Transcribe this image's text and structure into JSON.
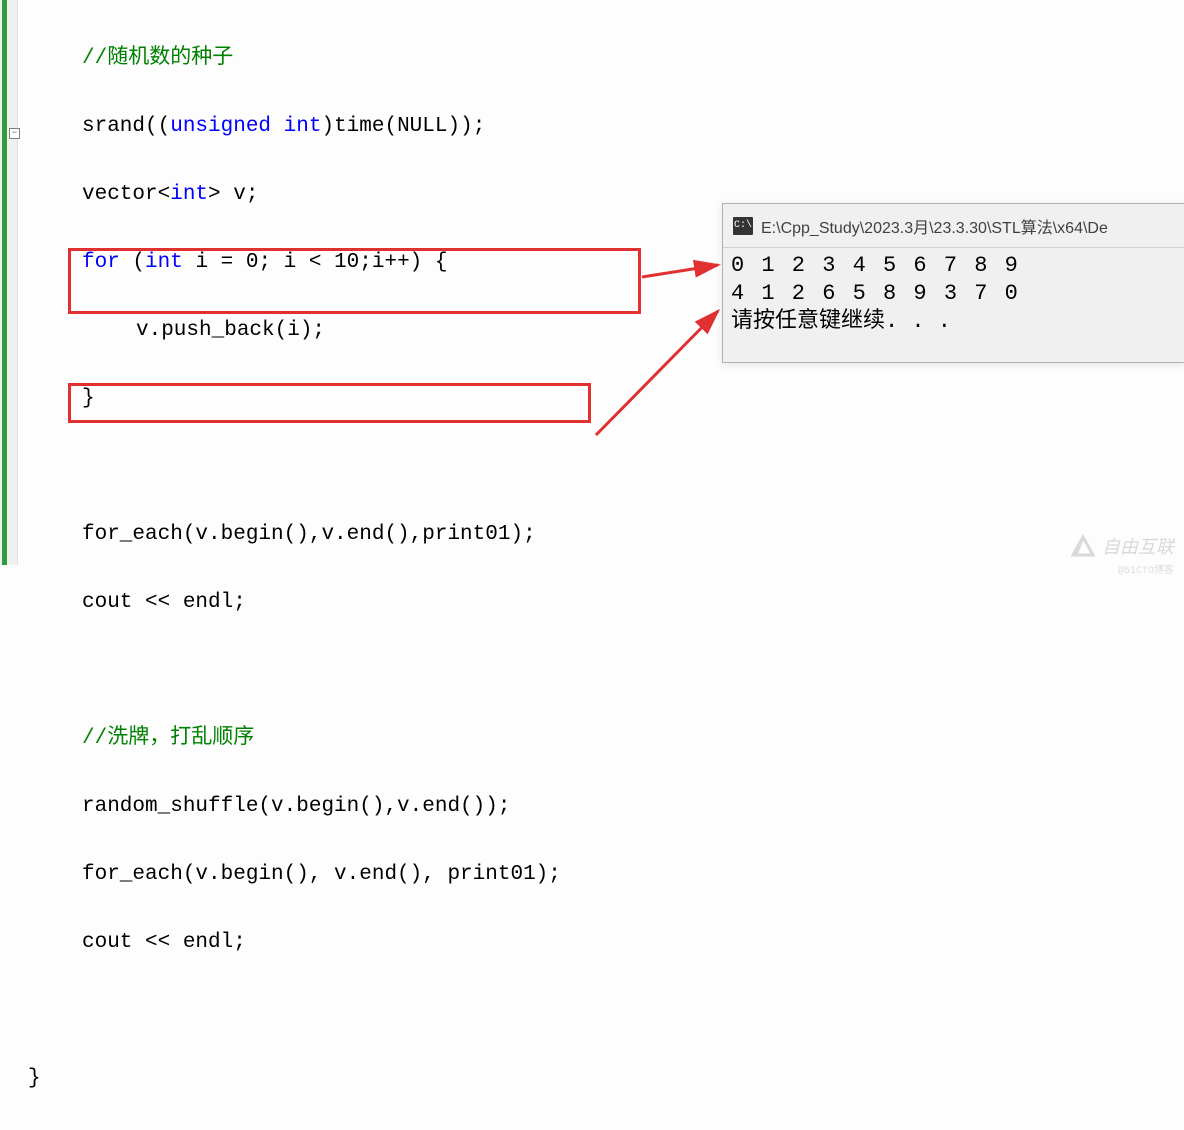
{
  "code": {
    "line1_comment": "//随机数的种子",
    "line2_p1": "srand((",
    "line2_kw1": "unsigned",
    "line2_sp1": " ",
    "line2_kw2": "int",
    "line2_p2": ")time(NULL));",
    "line3_p1": "vector<",
    "line3_kw1": "int",
    "line3_p2": "> v;",
    "line4_kw1": "for",
    "line4_p1": " (",
    "line4_kw2": "int",
    "line4_p2": " i = 0; i < 10;i++) {",
    "line5": "v.push_back(i);",
    "line6": "}",
    "line8": "for_each(v.begin(),v.end(),print01);",
    "line9": "cout << endl;",
    "line11_comment": "//洗牌，打乱顺序",
    "line12": "random_shuffle(v.begin(),v.end());",
    "line13": "for_each(v.begin(), v.end(), print01);",
    "line14": "cout << endl;",
    "line16": "}"
  },
  "console": {
    "icon": "C:\\",
    "title": "E:\\Cpp_Study\\2023.3月\\23.3.30\\STL算法\\x64\\De",
    "out1": "0 1 2 3 4 5 6 7 8 9",
    "out2": "4 1 2 6 5 8 9 3 7 0",
    "out3": "请按任意键继续. . ."
  },
  "fold_marker": "−",
  "watermark": "自由互联",
  "watermark_sub": "@51CTO博客"
}
